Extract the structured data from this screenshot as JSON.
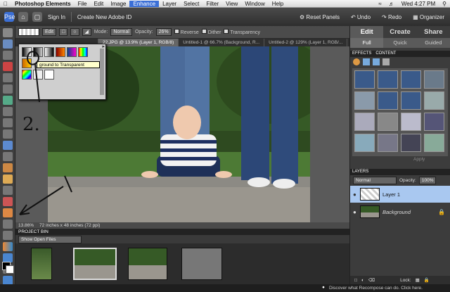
{
  "menubar": {
    "app_name": "Photoshop Elements",
    "items": [
      "File",
      "Edit",
      "Image",
      "Enhance",
      "Layer",
      "Select",
      "Filter",
      "View",
      "Window",
      "Help"
    ],
    "selected": "Enhance",
    "clock": "Wed 4:27 PM"
  },
  "apphead": {
    "sign_in": "Sign In",
    "create_id": "Create New Adobe ID",
    "reset_panels": "Reset Panels",
    "undo": "Undo",
    "redo": "Redo",
    "organizer": "Organizer"
  },
  "options": {
    "edit_label": "Edit",
    "mode_label": "Mode:",
    "mode_value": "Normal",
    "opacity_label": "Opacity:",
    "opacity_value": "26%",
    "reverse": "Reverse",
    "dither": "Dither",
    "transparency": "Transparency"
  },
  "doc_tabs": [
    "22.JPG @ 13.9% (Layer 1, RGB/8)",
    "Untitled-1 @ 66.7% (Background, R...",
    "Untitled-2 @ 129% (Layer 1, RGB/..."
  ],
  "tooltip": "ground to Transparent",
  "status": {
    "zoom": "13.86%",
    "size": "72 inches x 48 inches (72 ppi)"
  },
  "project_bin": {
    "title": "PROJECT BIN",
    "show": "Show Open Files"
  },
  "right_panel": {
    "tabs": [
      "Edit",
      "Create",
      "Share"
    ],
    "subtabs": [
      "Full",
      "Quick",
      "Guided"
    ],
    "effects_tabs": [
      "EFFECTS",
      "CONTENT"
    ],
    "apply": "Apply",
    "layers_title": "LAYERS",
    "blend_mode": "Normal",
    "opacity_label": "Opacity:",
    "opacity_value": "100%",
    "layers": [
      "Layer 1",
      "Background"
    ],
    "lock_label": "Lock:"
  },
  "bottom_tip": "Discover what Recompose can do. Click here.",
  "colors": {
    "accent": "#3b6fd6",
    "active_layer": "#a9c8f0"
  }
}
